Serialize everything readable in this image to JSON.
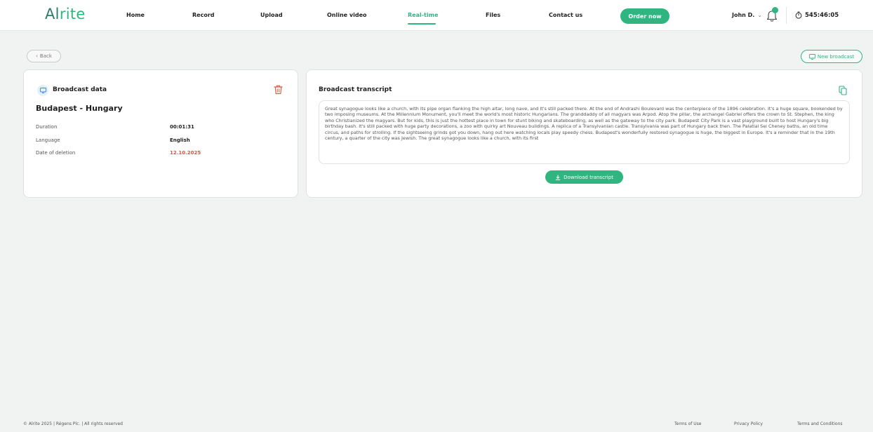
{
  "app": {
    "logo": {
      "prefix": "Al",
      "suffix": "rite"
    }
  },
  "nav": {
    "items": [
      {
        "label": "Home",
        "active": false
      },
      {
        "label": "Record",
        "active": false
      },
      {
        "label": "Upload",
        "active": false
      },
      {
        "label": "Online video",
        "active": false
      },
      {
        "label": "Real-time",
        "active": true
      },
      {
        "label": "Files",
        "active": false
      },
      {
        "label": "Contact us",
        "active": false
      }
    ],
    "order_label": "Order now",
    "user_name": "John D.",
    "user_chevron_icon": "chevron-down-icon",
    "bell_icon": "bell-icon",
    "bell_badge": "",
    "timer_icon": "stopwatch-icon",
    "timer_value": "545:46:05"
  },
  "actions": {
    "back_label": "Back",
    "back_icon": "chevron-left-icon",
    "new_broadcast_label": "New broadcast",
    "new_broadcast_icon": "broadcast-icon"
  },
  "broadcast": {
    "title": "Broadcast data",
    "icon": "broadcast-icon",
    "delete_icon": "trash-icon",
    "location": "Budapest - Hungary",
    "fields": [
      {
        "label": "Duration",
        "value": "00:01:31"
      },
      {
        "label": "Language",
        "value": "English"
      },
      {
        "label": "Date of deletion",
        "value": "12.10.2025"
      }
    ]
  },
  "transcript": {
    "title": "Broadcast transcript",
    "copy_icon": "copy-icon",
    "text": "Great synagogue looks like a church, with its pipe organ flanking the high altar, long nave, and It's still packed there. At the end of Andrashi Boulevard was the centerpiece of the 1896 celebration. It's a huge square, bookended by two imposing museums. At the Millennium Monument, you'll meet the world's most historic Hungarians. The granddaddy of all magyars was Arpod. Atop the pillar, the archangel Gabriel offers the crown to St. Stephen, the king who Christianized the magyars. But for kids, this is just the hottest place in town for stunt biking and skateboarding, as well as the gateway to the city park. Budapest City Park is a vast playground built to host Hungary's big birthday bash. It's still packed with huge party decorations, a zoo with quirky art Nouveau buildings. A replica of a Transylvanian castle. Transylvania was part of Hungary back then. The Palatial Sei Cheney baths, an old time circus, and paths for strolling. If the sightseeing grinds got you down, hang out here watching locals play speedy chess. Budapest's wonderfully restored synagogue is huge, the biggest in Europe. It's a reminder that in the 19th century, a quarter of the city was Jewish. The great synagogue looks like a church, with its first",
    "download_label": "Download transcript",
    "download_icon": "download-icon"
  },
  "footer": {
    "copyright": "© Alrite 2025 | Régens Plc. | All rights reserved",
    "links": [
      "Terms of Use",
      "Privacy Policy",
      "Terms and Conditions"
    ]
  },
  "colors": {
    "accent": "#2fb580",
    "danger": "#e0533e",
    "background": "#f1f3f2"
  }
}
